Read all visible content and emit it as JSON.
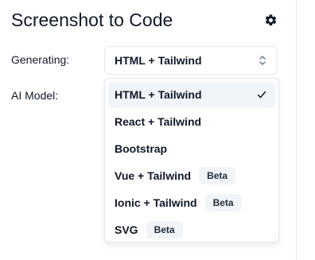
{
  "header": {
    "title": "Screenshot to Code",
    "settings_icon": "gear-icon"
  },
  "form": {
    "generating_label": "Generating:",
    "model_label": "AI Model:",
    "stack_select": {
      "selected_value": "HTML + Tailwind",
      "icon": "chevron-updown-icon"
    }
  },
  "dropdown": {
    "options": [
      {
        "label": "HTML + Tailwind",
        "badge": "",
        "selected": true
      },
      {
        "label": "React + Tailwind",
        "badge": "",
        "selected": false
      },
      {
        "label": "Bootstrap",
        "badge": "",
        "selected": false
      },
      {
        "label": "Vue + Tailwind",
        "badge": "Beta",
        "selected": false
      },
      {
        "label": "Ionic + Tailwind",
        "badge": "Beta",
        "selected": false
      },
      {
        "label": "SVG",
        "badge": "Beta",
        "selected": false
      }
    ],
    "check_icon": "check-icon"
  },
  "colors": {
    "text": "#111827",
    "border": "#e2e8f0",
    "highlight": "#f1f5f9"
  }
}
